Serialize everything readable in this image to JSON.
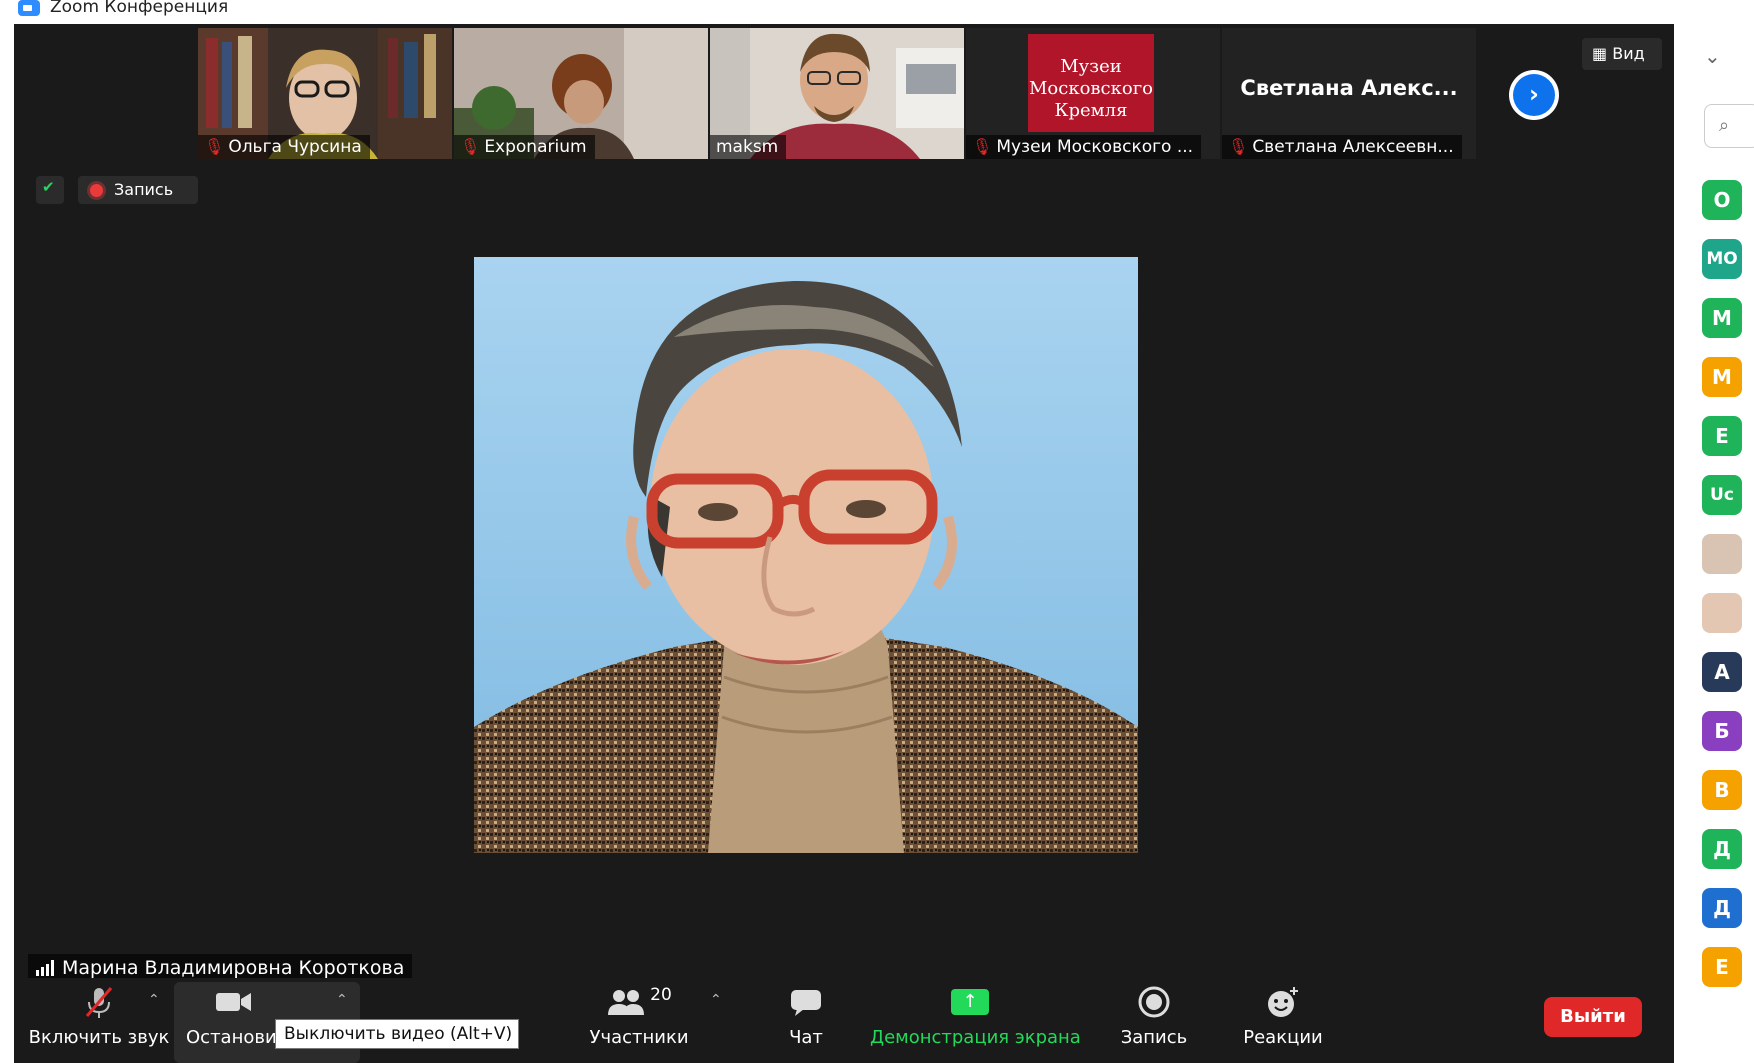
{
  "window": {
    "title": "Zoom Конференция"
  },
  "thumbnails": [
    {
      "name": "Ольга Чурсина",
      "muted": true
    },
    {
      "name": "Exponarium",
      "muted": true
    },
    {
      "name": "maksm",
      "muted": false
    },
    {
      "name": "Музеи Московского ...",
      "muted": true,
      "logo_lines": [
        "Музеи",
        "Московского",
        "Кремля"
      ]
    },
    {
      "name": "Светлана Алексеевн...",
      "muted": true,
      "display_name": "Светлана Алекс..."
    }
  ],
  "view_button": "Вид",
  "recording_indicator": "Запись",
  "active_speaker": "Марина Владимировна Короткова",
  "toolbar": {
    "audio": "Включить звук",
    "video": "Остановит",
    "participants": "Участники",
    "participants_count": "20",
    "chat": "Чат",
    "share": "Демонстрация экрана",
    "record": "Запись",
    "reactions": "Реакции",
    "leave": "Выйти"
  },
  "tooltip": "Выключить видео (Alt+V)",
  "sidebar": {
    "avatars": [
      {
        "label": "О",
        "color": "#1fb35a"
      },
      {
        "label": "МО",
        "color": "#1fa58a"
      },
      {
        "label": "М",
        "color": "#1fb35a"
      },
      {
        "label": "М",
        "color": "#f5a100"
      },
      {
        "label": "Е",
        "color": "#1fb35a"
      },
      {
        "label": "Uc",
        "color": "#1fb35a"
      },
      {
        "label": "",
        "color": "#d9c3b3"
      },
      {
        "label": "",
        "color": "#e4c7b2"
      },
      {
        "label": "А",
        "color": "#283a5a"
      },
      {
        "label": "Б",
        "color": "#8a3fc0"
      },
      {
        "label": "В",
        "color": "#f5a100"
      },
      {
        "label": "Д",
        "color": "#1fb35a"
      },
      {
        "label": "Д",
        "color": "#1f6fd1"
      },
      {
        "label": "Е",
        "color": "#f5a100"
      }
    ]
  }
}
